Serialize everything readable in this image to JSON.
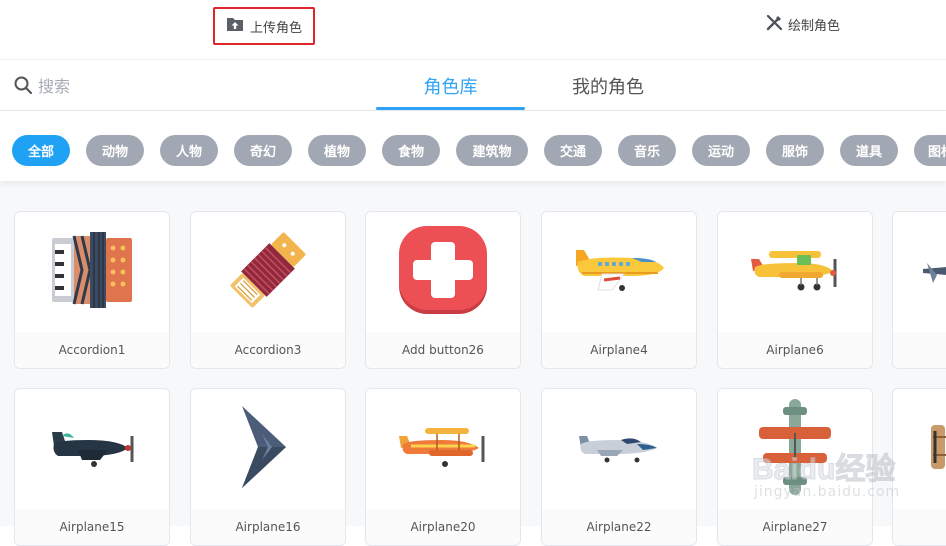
{
  "toolbar": {
    "upload_label": "上传角色",
    "draw_label": "绘制角色",
    "highlight_color": "#e0242c"
  },
  "search": {
    "placeholder": "搜索",
    "value": ""
  },
  "tabs": [
    {
      "label": "角色库",
      "active": true
    },
    {
      "label": "我的角色",
      "active": false
    }
  ],
  "accent": "#1fa1f4",
  "categories": [
    {
      "label": "全部",
      "active": true
    },
    {
      "label": "动物"
    },
    {
      "label": "人物"
    },
    {
      "label": "奇幻"
    },
    {
      "label": "植物"
    },
    {
      "label": "食物"
    },
    {
      "label": "建筑物"
    },
    {
      "label": "交通"
    },
    {
      "label": "音乐"
    },
    {
      "label": "运动"
    },
    {
      "label": "服饰"
    },
    {
      "label": "道具"
    },
    {
      "label": "图标"
    }
  ],
  "sprites": [
    {
      "name": "Accordion1",
      "icon": "accordion-icon"
    },
    {
      "name": "Accordion3",
      "icon": "accordion-tilted-icon"
    },
    {
      "name": "Add button26",
      "icon": "plus-button-icon"
    },
    {
      "name": "Airplane4",
      "icon": "yellow-airplane-icon"
    },
    {
      "name": "Airplane6",
      "icon": "biplane-icon"
    },
    {
      "name": "",
      "icon": "airplane-partial-icon"
    },
    {
      "name": "Airplane15",
      "icon": "dark-fighter-plane-icon"
    },
    {
      "name": "Airplane16",
      "icon": "stealth-bomber-icon"
    },
    {
      "name": "Airplane20",
      "icon": "orange-biplane-icon"
    },
    {
      "name": "Airplane22",
      "icon": "silver-jet-icon"
    },
    {
      "name": "Airplane27",
      "icon": "green-biplane-topview-icon"
    },
    {
      "name": "",
      "icon": "brown-biplane-partial-icon"
    }
  ],
  "watermark": {
    "main": "Baidu经验",
    "sub": "jingyan.baidu.com"
  }
}
